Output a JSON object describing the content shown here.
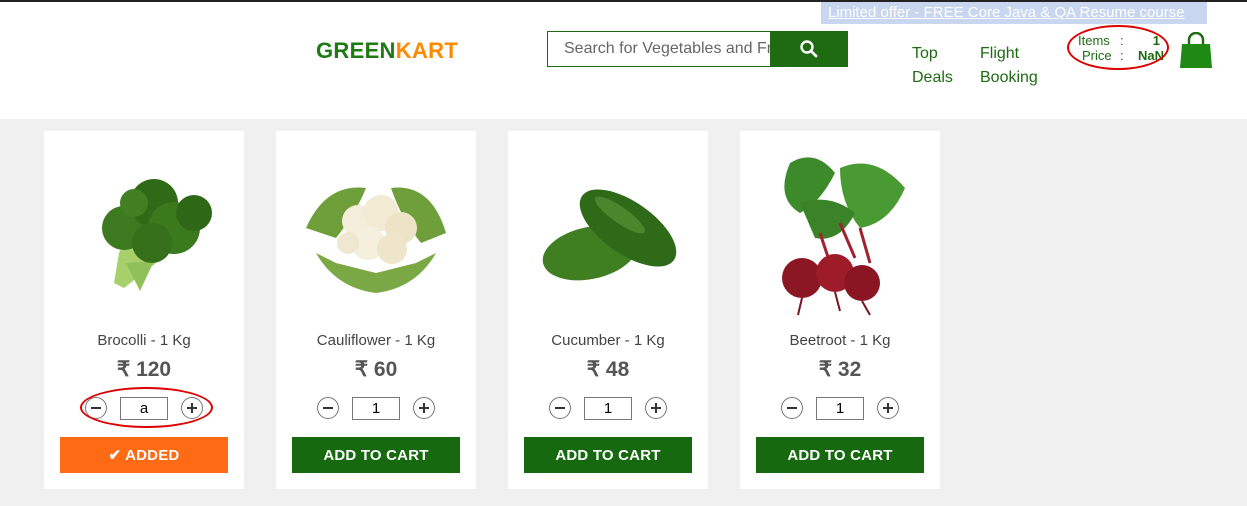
{
  "offer": {
    "text": "Limited offer - FREE Core Java & QA Resume course"
  },
  "logo": {
    "part1": "GREEN",
    "part2": "KART"
  },
  "search": {
    "placeholder": "Search for Vegetables and Fruits"
  },
  "nav": {
    "top_deals": [
      "Top",
      "Deals"
    ],
    "flight_booking": [
      "Flight",
      "Booking"
    ]
  },
  "cart_info": {
    "items_label": "Items",
    "items_value": "1",
    "price_label": "Price",
    "price_value": "NaN",
    "separator": ":"
  },
  "products": [
    {
      "name": "Brocolli - 1 Kg",
      "price": "₹ 120",
      "quantity": "a",
      "button": "✔ ADDED",
      "state": "added"
    },
    {
      "name": "Cauliflower - 1 Kg",
      "price": "₹ 60",
      "quantity": "1",
      "button": "ADD TO CART",
      "state": "default"
    },
    {
      "name": "Cucumber - 1 Kg",
      "price": "₹ 48",
      "quantity": "1",
      "button": "ADD TO CART",
      "state": "default"
    },
    {
      "name": "Beetroot - 1 Kg",
      "price": "₹ 32",
      "quantity": "1",
      "button": "ADD TO CART",
      "state": "default"
    }
  ],
  "colors": {
    "brand_green": "#1e6b12",
    "brand_orange": "#ff8a00",
    "added_orange": "#ff6a14",
    "annotation_red": "#dd0000"
  },
  "icons": {
    "search": "search-icon",
    "cart": "shopping-bag-icon",
    "minus": "minus-icon",
    "plus": "plus-icon"
  }
}
